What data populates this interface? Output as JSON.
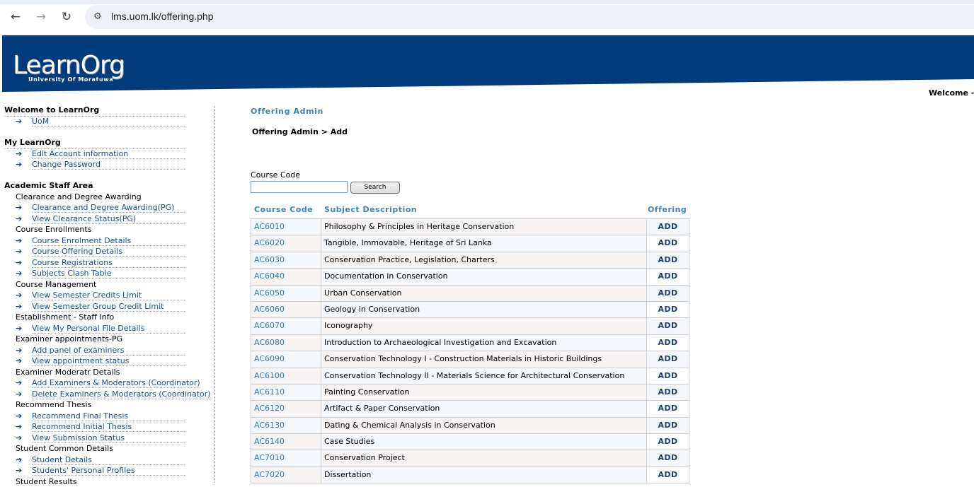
{
  "browser": {
    "url": "lms.uom.lk/offering.php"
  },
  "header": {
    "logo_main": "LearnOrg",
    "logo_sub": "University Of Moratuwa",
    "welcome": "Welcome -"
  },
  "sidebar": {
    "welcome_title": "Welcome to LearnOrg",
    "welcome_items": [
      "UoM"
    ],
    "my_title": "My LearnOrg",
    "my_items": [
      "Edit Account information",
      "Change Password"
    ],
    "staff_title": "Academic Staff Area",
    "categories": [
      {
        "name": "Clearance and Degree Awarding",
        "items": [
          "Clearance and Degree Awarding(PG)",
          "View Clearance Status(PG)"
        ]
      },
      {
        "name": "Course Enrollments",
        "items": [
          "Course Enrolment Details",
          "Course Offering Details",
          "Course Registrations",
          "Subjects Clash Table"
        ]
      },
      {
        "name": "Course Management",
        "items": [
          "View Semester Credits Limit",
          "View Semester Group Credit Limit"
        ]
      },
      {
        "name": "Establishment - Staff Info",
        "items": [
          "View My Personal File Details"
        ]
      },
      {
        "name": "Examiner appointments-PG",
        "items": [
          "Add panel of examiners",
          "View appointment status"
        ]
      },
      {
        "name": "Examiner Moderatr Details",
        "items": [
          "Add Examiners & Moderators (Coordinator)",
          "Delete Examiners & Moderators (Coordinator)"
        ]
      },
      {
        "name": "Recommend Thesis",
        "items": [
          "Recommend Final Thesis",
          "Recommend Initial Thesis",
          "View Submission Status"
        ]
      },
      {
        "name": "Student Common Details",
        "items": [
          "Student Details",
          "Students' Personal Profiles"
        ]
      },
      {
        "name": "Student Results",
        "items": []
      }
    ]
  },
  "main": {
    "heading": "Offering Admin",
    "breadcrumb": "Offering Admin > Add",
    "search_label": "Course Code",
    "search_value": "",
    "search_button": "Search",
    "columns": {
      "code": "Course Code",
      "desc": "Subject Description",
      "offering": "Offering"
    },
    "rows": [
      {
        "code": "AC6010",
        "desc": "Philosophy & Principles in Heritage Conservation",
        "action": "ADD"
      },
      {
        "code": "AC6020",
        "desc": "Tangible, Immovable, Heritage of Sri Lanka",
        "action": "ADD"
      },
      {
        "code": "AC6030",
        "desc": "Conservation Practice, Legislation, Charters",
        "action": "ADD"
      },
      {
        "code": "AC6040",
        "desc": "Documentation in Conservation",
        "action": "ADD"
      },
      {
        "code": "AC6050",
        "desc": "Urban Conservation",
        "action": "ADD"
      },
      {
        "code": "AC6060",
        "desc": "Geology in Conservation",
        "action": "ADD"
      },
      {
        "code": "AC6070",
        "desc": "Iconography",
        "action": "ADD"
      },
      {
        "code": "AC6080",
        "desc": "Introduction to Archaeological Investigation and Excavation",
        "action": "ADD"
      },
      {
        "code": "AC6090",
        "desc": "Conservation Technology I - Construction Materials in Historic Buildings",
        "action": "ADD"
      },
      {
        "code": "AC6100",
        "desc": "Conservation Technology II - Materials Science for Architectural Conservation",
        "action": "ADD"
      },
      {
        "code": "AC6110",
        "desc": "Painting Conservation",
        "action": "ADD"
      },
      {
        "code": "AC6120",
        "desc": "Artifact & Paper Conservation",
        "action": "ADD"
      },
      {
        "code": "AC6130",
        "desc": "Dating & Chemical Analysis in Conservation",
        "action": "ADD"
      },
      {
        "code": "AC6140",
        "desc": "Case Studies",
        "action": "ADD"
      },
      {
        "code": "AC7010",
        "desc": "Conservation Project",
        "action": "ADD"
      },
      {
        "code": "AC7020",
        "desc": "Dissertation",
        "action": "ADD"
      }
    ]
  }
}
